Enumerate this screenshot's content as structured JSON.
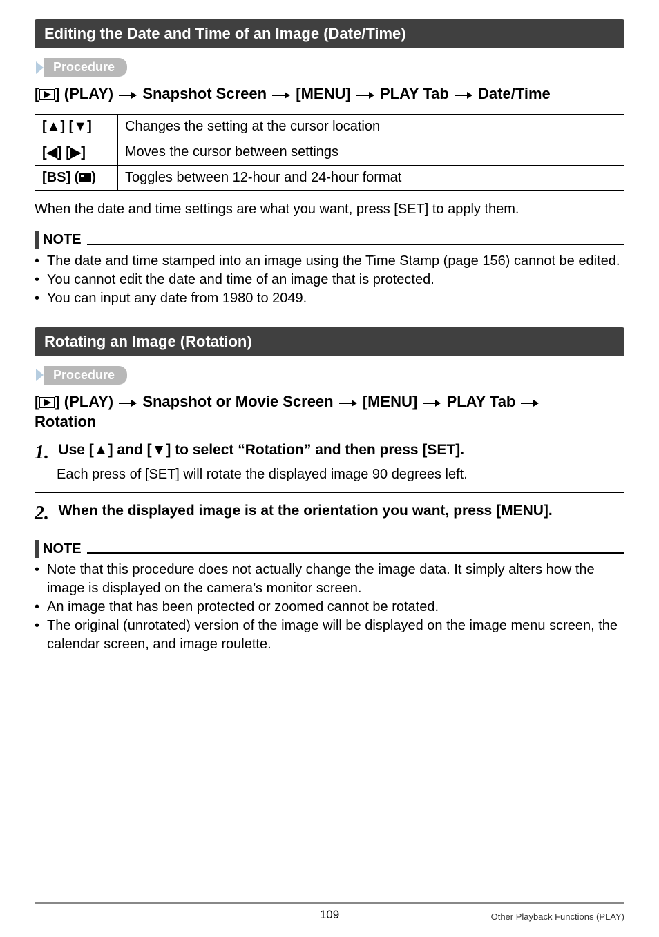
{
  "section1": {
    "title": "Editing the Date and Time of an Image (Date/Time)",
    "procedure_label": "Procedure",
    "procedure_line_parts": [
      "[",
      "] (PLAY) ",
      " Snapshot Screen ",
      " [MENU] ",
      " PLAY Tab ",
      " Date/Time"
    ],
    "table": [
      {
        "key": "[▲] [▼]",
        "val": "Changes the setting at the cursor location"
      },
      {
        "key": "[◀] [▶]",
        "val": "Moves the cursor between settings"
      },
      {
        "key": "[BS] (🅱)",
        "key_plain": "[BS] (",
        "val": "Toggles between 12-hour and 24-hour format"
      }
    ],
    "after_table": "When the date and time settings are what you want, press [SET] to apply them.",
    "note_label": "NOTE",
    "notes": [
      "The date and time stamped into an image using the Time Stamp (page 156) cannot be edited.",
      "You cannot edit the date and time of an image that is protected.",
      "You can input any date from 1980 to 2049."
    ]
  },
  "section2": {
    "title": "Rotating an Image (Rotation)",
    "procedure_label": "Procedure",
    "procedure_line_parts": [
      "[",
      "] (PLAY) ",
      " Snapshot or Movie Screen ",
      " [MENU] ",
      " PLAY Tab ",
      " Rotation"
    ],
    "step1_title": "Use [▲] and [▼] to select “Rotation” and then press [SET].",
    "step1_body": "Each press of [SET] will rotate the displayed image 90 degrees left.",
    "step2_title": "When the displayed image is at the orientation you want, press [MENU].",
    "note_label": "NOTE",
    "notes": [
      "Note that this procedure does not actually change the image data. It simply alters how the image is displayed on the camera’s monitor screen.",
      "An image that has been protected or zoomed cannot be rotated.",
      "The original (unrotated) version of the image will be displayed on the image menu screen, the calendar screen, and image roulette."
    ]
  },
  "footer": {
    "page": "109",
    "right": "Other Playback Functions (PLAY)"
  }
}
